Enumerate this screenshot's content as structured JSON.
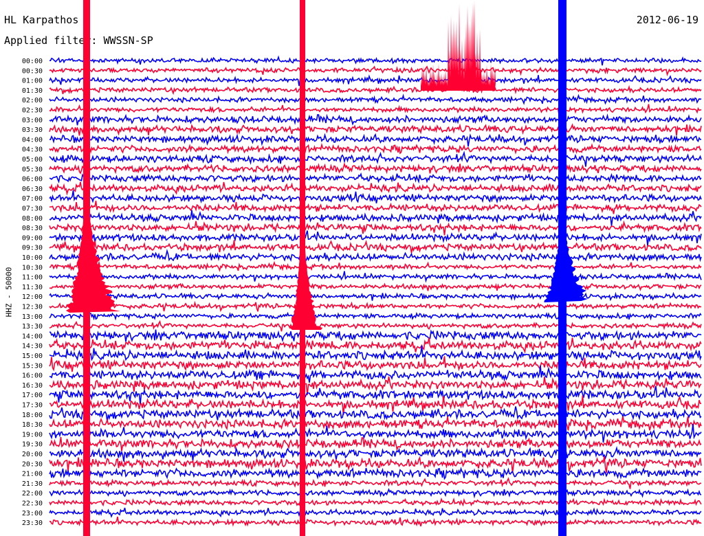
{
  "header": {
    "station": "HL Karpathos",
    "filter": "Applied filter: WWSSN-SP",
    "date": "2012-06-19"
  },
  "chart_data": {
    "type": "line",
    "title": "HL Karpathos",
    "subtitle": "Applied filter: WWSSN-SP",
    "date": "2012-06-19",
    "ylabel": "HHZ - 50000",
    "row_labels": [
      "00:00",
      "00:30",
      "01:00",
      "01:30",
      "02:00",
      "02:30",
      "03:00",
      "03:30",
      "04:00",
      "04:30",
      "05:00",
      "05:30",
      "06:00",
      "06:30",
      "07:00",
      "07:30",
      "08:00",
      "08:30",
      "09:00",
      "09:30",
      "10:00",
      "10:30",
      "11:00",
      "11:30",
      "12:00",
      "12:30",
      "13:00",
      "13:30",
      "14:00",
      "14:30",
      "15:00",
      "15:30",
      "16:00",
      "16:30",
      "17:00",
      "17:30",
      "18:00",
      "18:30",
      "19:00",
      "19:30",
      "20:00",
      "20:30",
      "21:00",
      "21:30",
      "22:00",
      "22:30",
      "23:00",
      "23:30"
    ],
    "row_minutes": 30,
    "colors": [
      "#0000ff",
      "#ff0033"
    ],
    "grid": false
  }
}
